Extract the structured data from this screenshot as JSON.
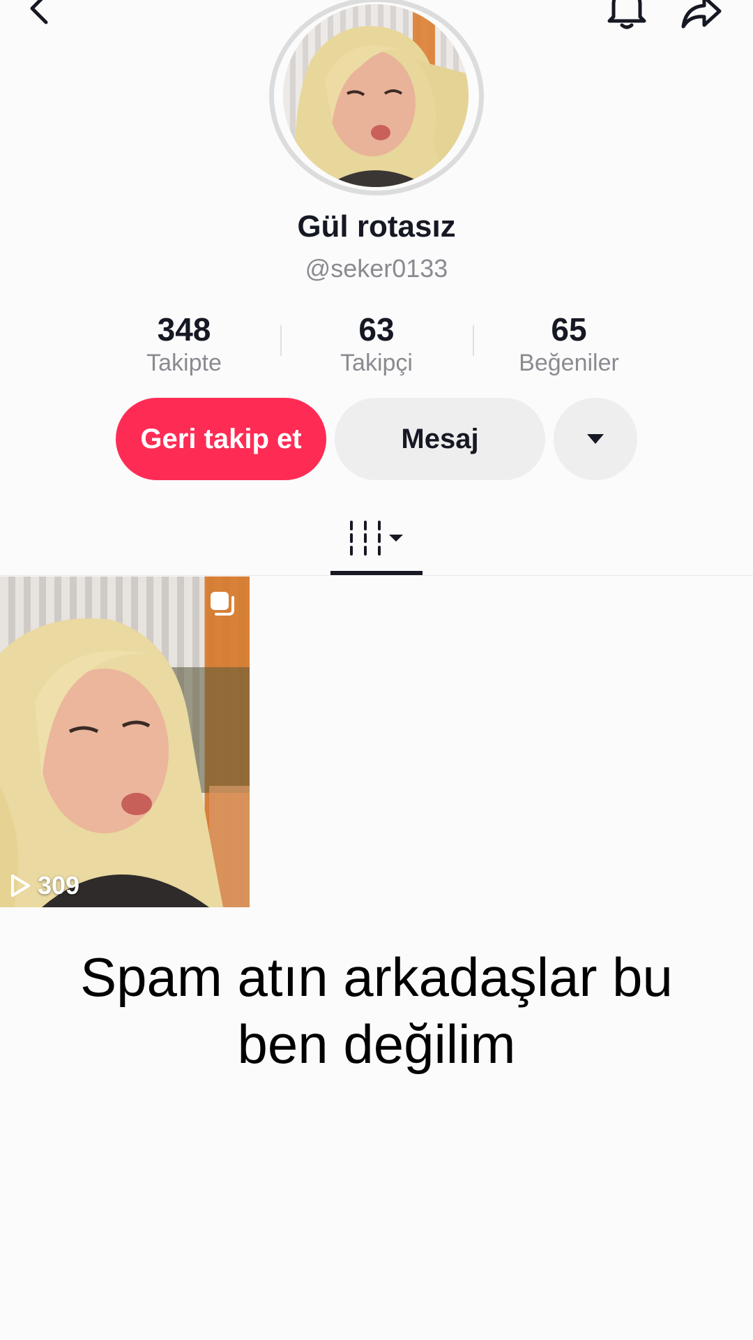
{
  "profile": {
    "display_name": "Gül rotasız",
    "username": "@seker0133"
  },
  "stats": {
    "following": {
      "value": "348",
      "label": "Takipte"
    },
    "followers": {
      "value": "63",
      "label": "Takipçi"
    },
    "likes": {
      "value": "65",
      "label": "Beğeniler"
    }
  },
  "actions": {
    "follow_back": "Geri takip et",
    "message": "Mesaj"
  },
  "videos": [
    {
      "views": "309"
    }
  ],
  "caption": "Spam atın arkadaşlar bu ben değilim",
  "colors": {
    "accent": "#fe2c55",
    "button_gray": "#eeeeee",
    "text": "#161823",
    "secondary_text": "#8a8b91"
  },
  "icons": [
    "back-icon",
    "bell-icon",
    "share-icon",
    "grid-icon",
    "chevron-down-icon",
    "multi-photo-icon",
    "play-icon"
  ]
}
